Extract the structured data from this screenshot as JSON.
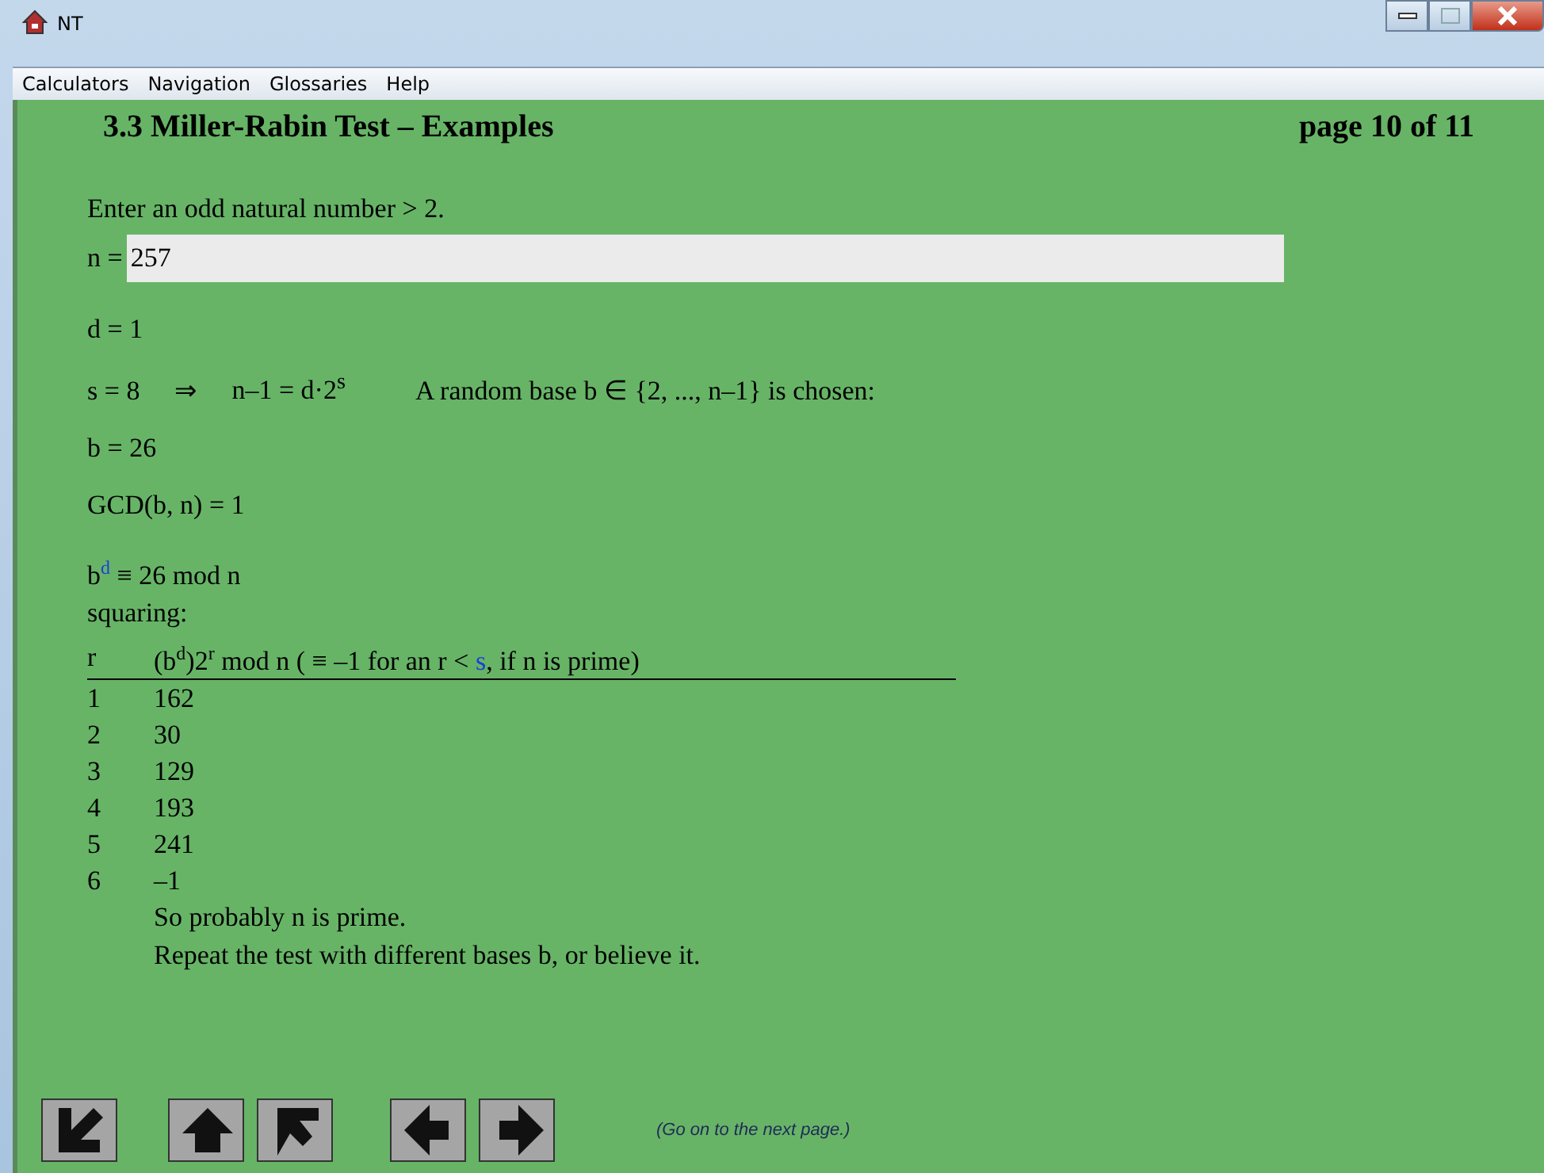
{
  "window": {
    "title": "NT"
  },
  "menu": [
    "Calculators",
    "Navigation",
    "Glossaries",
    "Help"
  ],
  "page": {
    "title": "3.3 Miller-Rabin Test – Examples",
    "number": "page 10 of 11"
  },
  "prompt": "Enter an odd natural number > 2.",
  "input": {
    "label": "n =",
    "value": "257"
  },
  "d_line": "d = 1",
  "s_line": {
    "left": "s = 8",
    "arrow": "⇒",
    "formula": "n–1 = d·2$^{s}$",
    "note": "A random base b ∈ {2, ..., n–1} is chosen:"
  },
  "b_line": "b = 26",
  "gcd_line": "GCD(b, n) = 1",
  "bd_line": [
    {
      "kind": "text",
      "text": "b"
    },
    {
      "kind": "sup-highlight",
      "text": "d"
    },
    {
      "kind": "text",
      "text": " ≡ 26 mod n"
    }
  ],
  "squaring": "squaring:",
  "table": {
    "columns": [
      {
        "segments": [
          {
            "kind": "text",
            "text": "r"
          }
        ]
      },
      {
        "segments": [
          {
            "kind": "text",
            "text": "(b"
          },
          {
            "kind": "sup",
            "text": "d"
          },
          {
            "kind": "text",
            "text": ")2"
          },
          {
            "kind": "sup",
            "text": "r"
          },
          {
            "kind": "text",
            "text": " mod n  ( ≡ –1 for an r < "
          },
          {
            "kind": "highlight",
            "text": "s"
          },
          {
            "kind": "text",
            "text": ", if n is prime)"
          }
        ]
      }
    ],
    "rows": [
      [
        "1",
        "162"
      ],
      [
        "2",
        "30"
      ],
      [
        "3",
        "129"
      ],
      [
        "4",
        "193"
      ],
      [
        "5",
        "241"
      ],
      [
        "6",
        "–1"
      ]
    ]
  },
  "conclusion": [
    "So probably n is prime.",
    "Repeat the test with different bases b, or believe it."
  ],
  "nav": [
    {
      "kind": "down-left"
    },
    {
      "kind": "up"
    },
    {
      "kind": "up-left"
    },
    {
      "kind": "left"
    },
    {
      "kind": "right"
    }
  ],
  "hint": "(Go on to the next page.)"
}
